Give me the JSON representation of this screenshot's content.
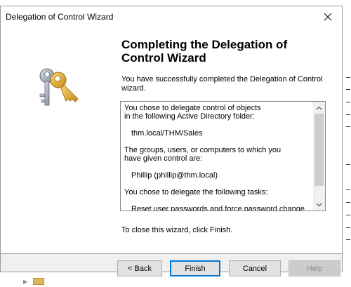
{
  "window": {
    "title": "Delegation of Control Wizard"
  },
  "heading": "Completing the Delegation of Control Wizard",
  "intro": "You have successfully completed the Delegation of Control wizard.",
  "summary": {
    "lines": [
      "You chose to delegate control of objects",
      "in the following Active Directory folder:",
      "thm.local/THM/Sales",
      "The groups, users, or computers to which you",
      "have given control are:",
      "Phillip (phillip@thm.local)",
      "You chose to delegate the following tasks:",
      "Reset user passwords and force password change at"
    ]
  },
  "close_instruction": "To close this wizard, click Finish.",
  "buttons": {
    "back": "< Back",
    "finish": "Finish",
    "cancel": "Cancel",
    "help": "Help"
  },
  "colors": {
    "finish_border": "#0078d7",
    "dialog_bg": "#f0f0f0"
  },
  "icons": {
    "banner": "keys-icon",
    "close": "close-icon"
  }
}
